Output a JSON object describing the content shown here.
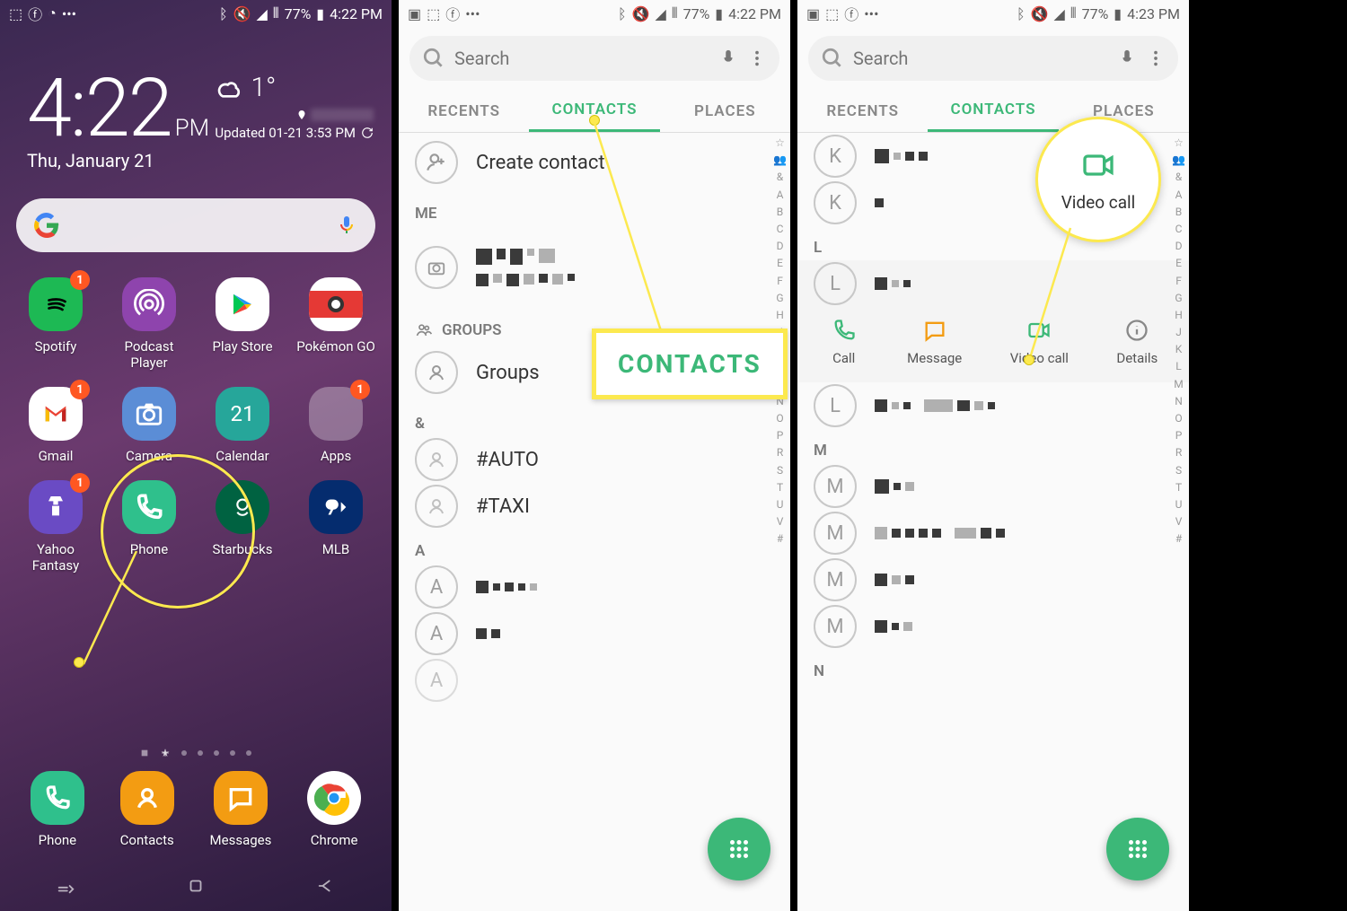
{
  "status": {
    "battery": "77%",
    "time1": "4:22 PM",
    "time3": "4:23 PM"
  },
  "home": {
    "clock": "4:22",
    "pm": "PM",
    "date": "Thu, January 21",
    "temp": "1°",
    "updated": "Updated 01-21 3:53 PM",
    "apps": {
      "spotify": "Spotify",
      "podcast": "Podcast Player",
      "playstore": "Play Store",
      "pokemon": "Pokémon GO",
      "gmail": "Gmail",
      "camera": "Camera",
      "calendar": "Calendar",
      "cal_day": "21",
      "apps": "Apps",
      "yahoo": "Yahoo Fantasy",
      "phone": "Phone",
      "starbucks": "Starbucks",
      "mlb": "MLB"
    },
    "dock": {
      "phone": "Phone",
      "contacts": "Contacts",
      "messages": "Messages",
      "chrome": "Chrome"
    },
    "badge1": "1"
  },
  "phone": {
    "search_ph": "Search",
    "tab_recents": "RECENTS",
    "tab_contacts": "CONTACTS",
    "tab_places": "PLACES",
    "create": "Create contact",
    "me": "ME",
    "groups_hdr": "GROUPS",
    "groups": "Groups",
    "amp": "&",
    "auto": "#AUTO",
    "taxi": "#TAXI",
    "A": "A",
    "K": "K",
    "L": "L",
    "M": "M",
    "N": "N",
    "callout": "CONTACTS",
    "actions": {
      "call": "Call",
      "message": "Message",
      "videocall": "Video call",
      "details": "Details"
    },
    "video_callout": "Video call",
    "index": [
      "☆",
      "👥",
      "&",
      "A",
      "B",
      "C",
      "D",
      "E",
      "F",
      "G",
      "H",
      "J",
      "K",
      "L",
      "M",
      "N",
      "O",
      "P",
      "R",
      "S",
      "T",
      "U",
      "V",
      "#"
    ]
  }
}
